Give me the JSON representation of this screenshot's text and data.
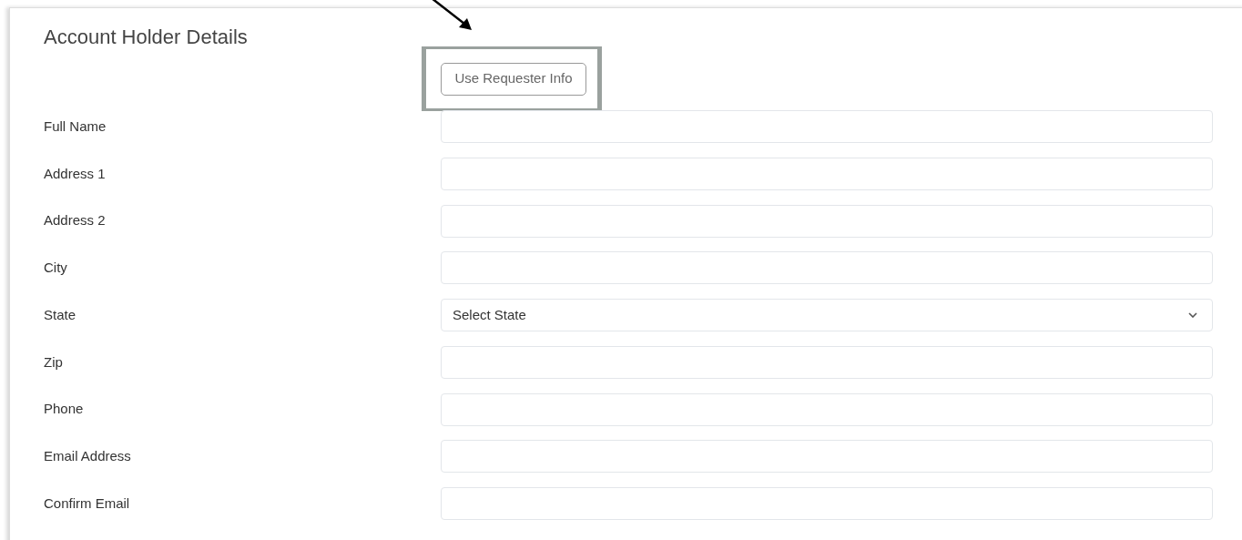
{
  "title": "Account Holder Details",
  "requester_button": {
    "label": "Use Requester Info"
  },
  "fields": [
    {
      "label": "Full Name",
      "kind": "text"
    },
    {
      "label": "Address 1",
      "kind": "text"
    },
    {
      "label": "Address 2",
      "kind": "text"
    },
    {
      "label": "City",
      "kind": "text"
    },
    {
      "label": "State",
      "kind": "select",
      "value": "Select State"
    },
    {
      "label": "Zip",
      "kind": "text"
    },
    {
      "label": "Phone",
      "kind": "text"
    },
    {
      "label": "Email Address",
      "kind": "text"
    },
    {
      "label": "Confirm Email",
      "kind": "text"
    }
  ]
}
